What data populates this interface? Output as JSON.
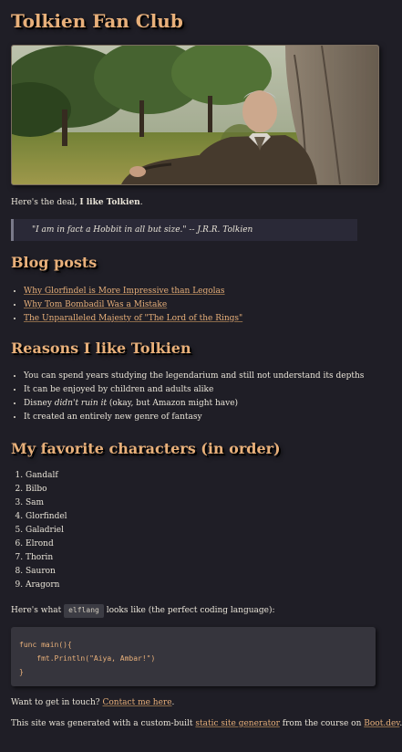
{
  "page": {
    "title": "Tolkien Fan Club"
  },
  "intro": {
    "prefix": "Here's the deal, ",
    "bold": "I like Tolkien",
    "suffix": "."
  },
  "quote": "\"I am in fact a Hobbit in all but size.\" -- J.R.R. Tolkien",
  "blog": {
    "heading": "Blog posts",
    "posts": [
      "Why Glorfindel is More Impressive than Legolas",
      "Why Tom Bombadil Was a Mistake",
      "The Unparalleled Majesty of \"The Lord of the Rings\""
    ]
  },
  "reasons": {
    "heading": "Reasons I like Tolkien",
    "items": [
      "You can spend years studying the legendarium and still not understand its depths",
      "It can be enjoyed by children and adults alike",
      "It created an entirely new genre of fantasy"
    ],
    "disney": {
      "prefix": "Disney ",
      "em": "didn't ruin it",
      "suffix": " (okay, but Amazon might have)"
    }
  },
  "characters": {
    "heading": "My favorite characters (in order)",
    "items": [
      "Gandalf",
      "Bilbo",
      "Sam",
      "Glorfindel",
      "Galadriel",
      "Elrond",
      "Thorin",
      "Sauron",
      "Aragorn"
    ]
  },
  "elflang": {
    "prefix": "Here's what ",
    "code": "elflang",
    "suffix": " looks like (the perfect coding language):"
  },
  "code_block": {
    "lines": [
      "func main(){",
      "    fmt.Println(\"Aiya, Ambar!\")",
      "}"
    ]
  },
  "contact": {
    "prefix": "Want to get in touch? ",
    "link": "Contact me here",
    "suffix": "."
  },
  "footer": {
    "prefix": "This site was generated with a custom-built ",
    "link1": "static site generator",
    "middle": " from the course on ",
    "link2": "Boot.dev",
    "suffix": "."
  },
  "colors": {
    "background": "#1f1e26",
    "heading": "#e8b07a",
    "text": "#e9e4d8",
    "quote_bg": "#2a2937",
    "code_bg": "#36353d"
  }
}
